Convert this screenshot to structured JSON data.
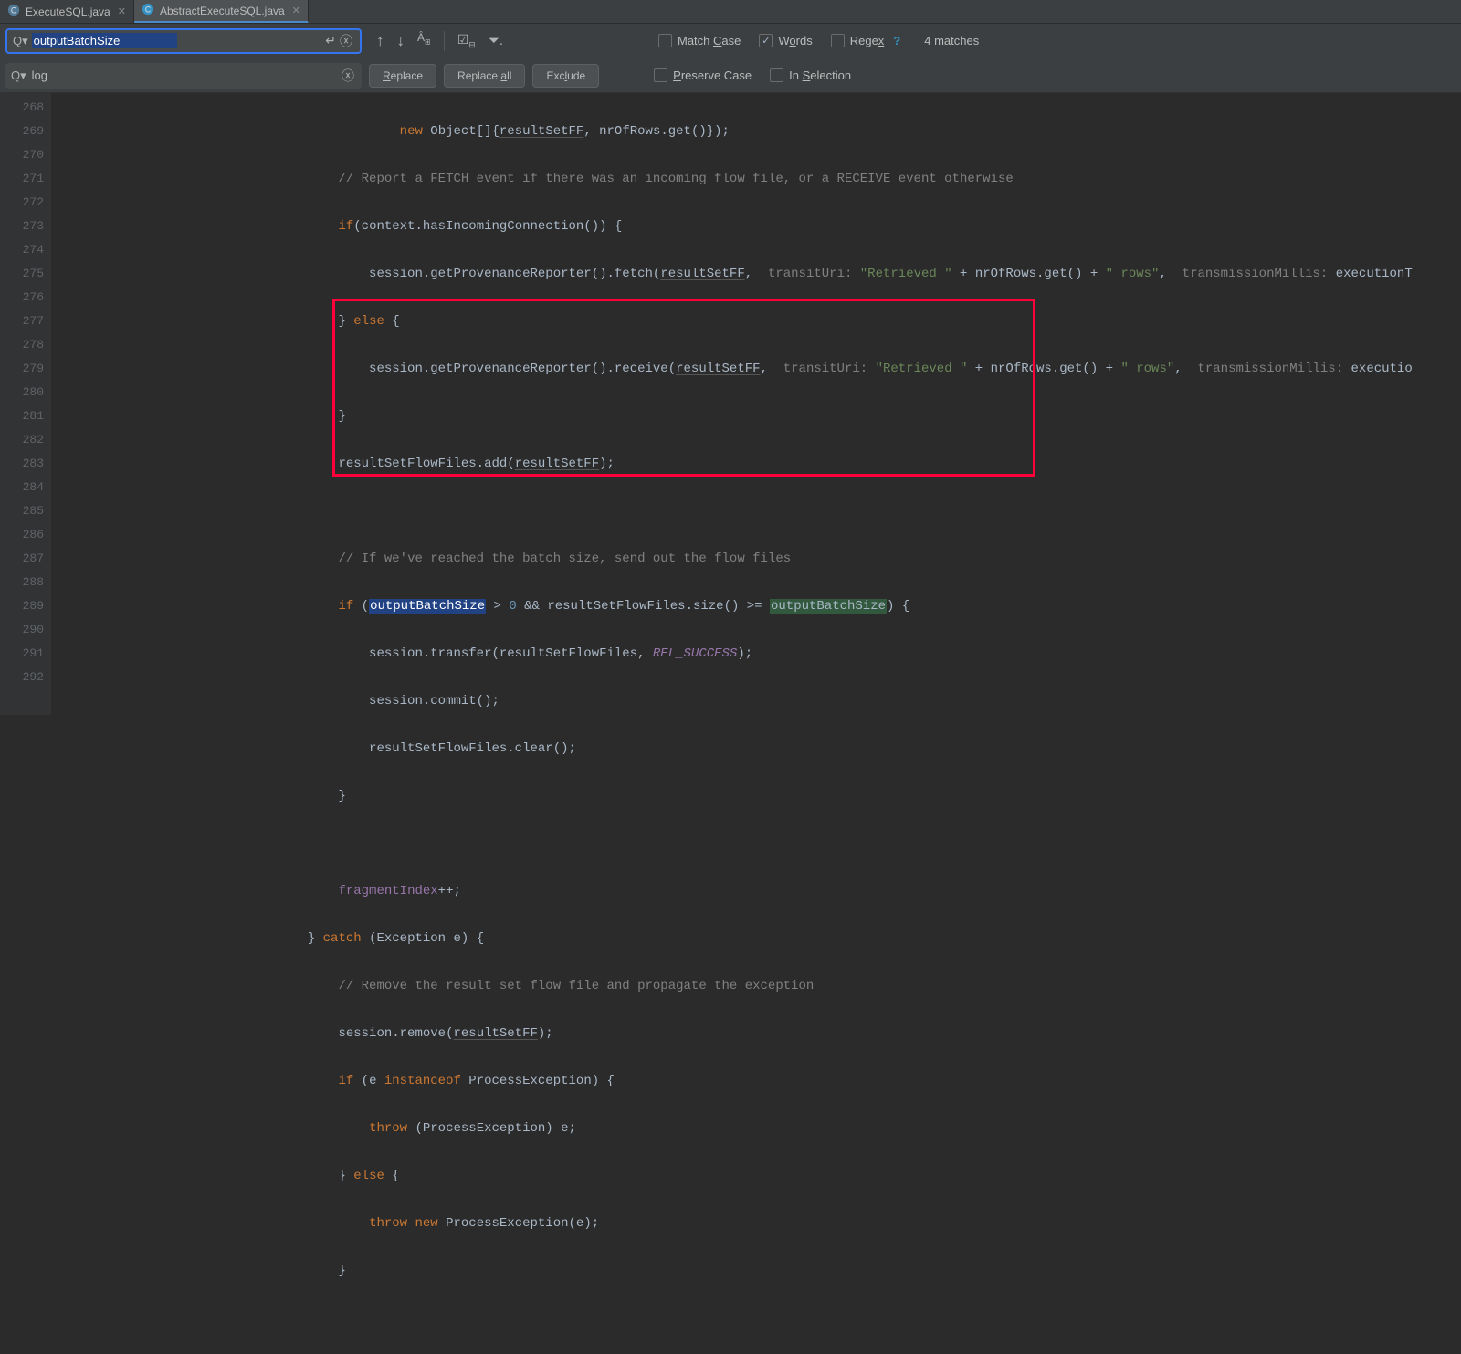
{
  "tabs": [
    {
      "label": "ExecuteSQL.java",
      "active": false
    },
    {
      "label": "AbstractExecuteSQL.java",
      "active": true
    }
  ],
  "find": {
    "query": "outputBatchSize",
    "matches": "4 matches",
    "matchCaseLabel": "Match Case",
    "wordsLabel": "Words",
    "regexLabel": "Regex",
    "wordsChecked": true
  },
  "replace": {
    "text": "log",
    "replaceBtn": "Replace",
    "replaceAllBtn": "Replace all",
    "excludeBtn": "Exclude",
    "preserveCaseLabel": "Preserve Case",
    "inSelectionLabel": "In Selection"
  },
  "lineStart": 268,
  "lineEnd": 292
}
